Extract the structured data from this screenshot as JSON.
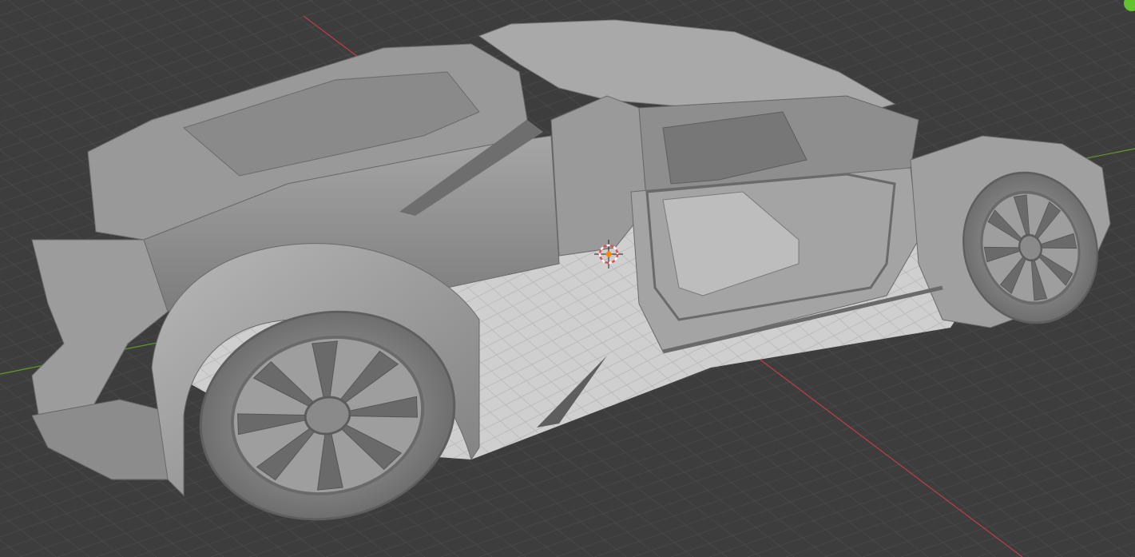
{
  "viewport": {
    "name": "3D Viewport",
    "background": "#3d3d3d",
    "grid_line_color": "#4a4a4a",
    "x_axis_color": "#c33c4b",
    "y_axis_color": "#5f9a28",
    "floor_color": "#cfcfcf",
    "model_color": "#8d8d8d",
    "cursor_colors": {
      "ring_a": "#e84b4b",
      "ring_b": "#ffffff",
      "center": "#ff8a00"
    },
    "corner_indicator_color": "#63c32e"
  },
  "scene": {
    "model": "sports-car",
    "shading": "solid",
    "visible_parts": [
      "body-shell",
      "front-wheel",
      "rear-wheel",
      "open-door",
      "seat",
      "dashboard",
      "floor-pan"
    ]
  }
}
